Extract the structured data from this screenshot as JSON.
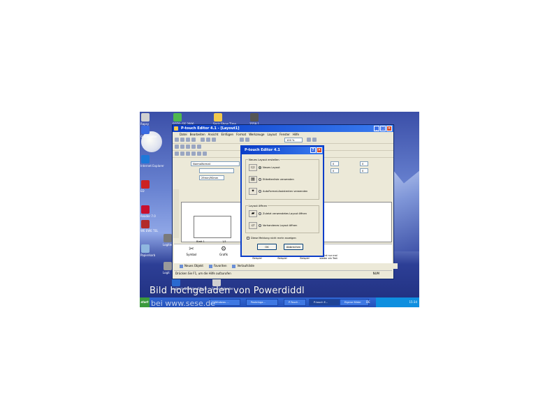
{
  "watermark": {
    "line1": "Bild hochgeladen von Powerdiddl",
    "line2": "bei www.sese.de"
  },
  "desktop": {
    "icons": [
      {
        "label": "Rapsy",
        "color": "#d0d0d0"
      },
      {
        "label": "FOTO. GE.2006",
        "color": "#4fb84f"
      },
      {
        "label": "Seris Show Time",
        "color": "#f2c94c"
      },
      {
        "label": "2559.1",
        "color": "#555"
      },
      {
        "label": "Ortsangabe",
        "color": "#3a6ae0"
      },
      {
        "label": "Internet Explorer",
        "color": "#1e78d8"
      },
      {
        "label": "ED",
        "color": "#cc2222"
      },
      {
        "label": "Reader 7.0",
        "color": "#c8102e"
      },
      {
        "label": "WE EWE TEL",
        "color": "#b22a2a"
      },
      {
        "label": "Papierkorb",
        "color": "#8fb7df"
      },
      {
        "label": "Logitech",
        "color": "#7a7a7a"
      },
      {
        "label": "Logit",
        "color": "#9a9a9a"
      },
      {
        "label": "Logitech QK Video Effects",
        "color": "#2a6ad0"
      },
      {
        "label": "Stand Kalender",
        "color": "#d0d0d0"
      }
    ]
  },
  "app": {
    "title": "P-touch Editor 4.1 - [Layout1]",
    "menu": [
      "Datei",
      "Bearbeiten",
      "Ansicht",
      "Einfügen",
      "Format",
      "Werkzeuge",
      "Layout",
      "Fenster",
      "Hilfe"
    ],
    "zoom": "100 %",
    "format_field": "Normalformat",
    "size_field": "29mm/90mm",
    "page_label": "Blatt 1",
    "page_count": "1/1",
    "spin_value1": "0",
    "spin_value2": "0",
    "spin_value3": "0",
    "spin_value4": "0",
    "panel_tools": [
      {
        "label": "Symbol",
        "icon": "✂"
      },
      {
        "label": "Grafik",
        "icon": "⚙"
      }
    ],
    "samples": [
      "Dies ist nur ein Beispiel",
      "dies ist nur ein Beispiel",
      "dies ist nur ein Beispiel",
      "das ist nur mal wieder ein Text"
    ],
    "tabs": [
      "Neues Objekt",
      "Favoriten",
      "Verlaufsliste"
    ],
    "status_text": "Drücken Sie F1, um die Hilfe aufzurufen",
    "status_num": "NUM"
  },
  "dialog": {
    "title": "P-touch Editor 4.1",
    "group1_label": "Neues Layout erstellen",
    "options_new": [
      "Neues Layout",
      "Etikettenliste verwenden",
      "AutoFormat-Assistenten verwenden"
    ],
    "group2_label": "Layout öffnen",
    "options_open": [
      "Zuletzt verwendetes Layout öffnen",
      "Vorhandenes Layout öffnen"
    ],
    "checkbox_label": "Diese Meldung nicht mehr anzeigen",
    "ok_label": "OK",
    "cancel_label": "Abbrechen",
    "selected": "Neues Layout"
  },
  "taskbar": {
    "start_label": "start",
    "tasks": [
      "Windows ...",
      "Posteinga...",
      "P-Touch -",
      "P-touch E...",
      "Eigene Bilder"
    ],
    "active_task": "P-touch E...",
    "lang": "DE",
    "clock": "15:34"
  }
}
